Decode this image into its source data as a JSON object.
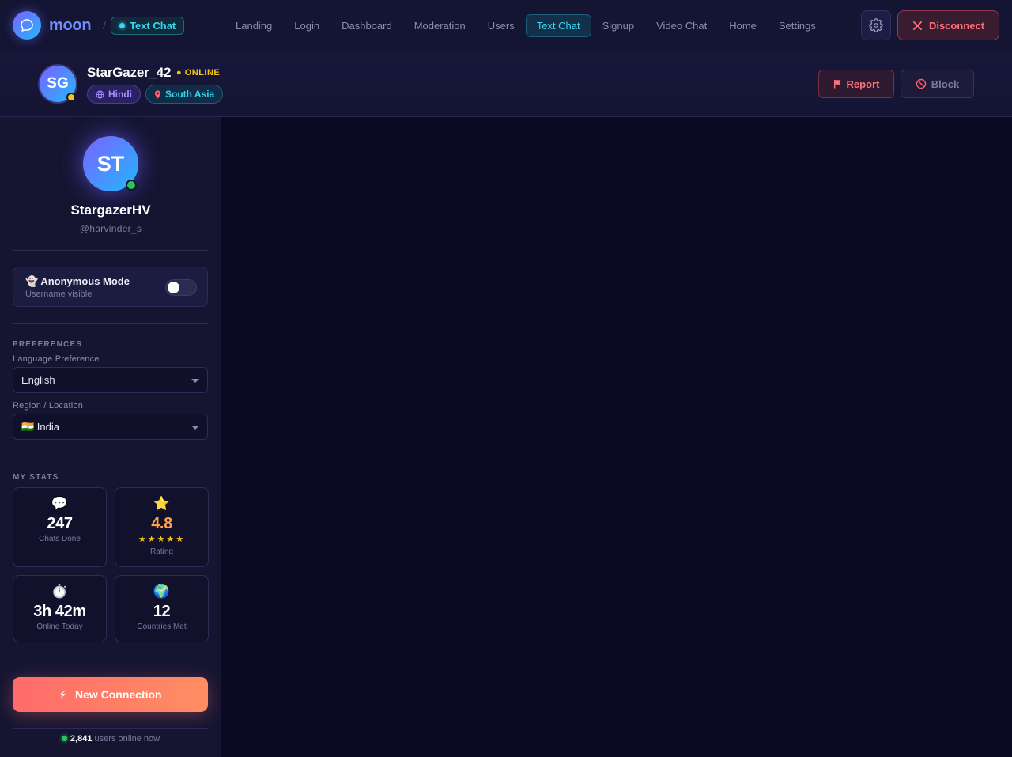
{
  "topbar": {
    "brand": "moon",
    "crumb_sep": "/",
    "crumb": "Text Chat",
    "nav": [
      {
        "label": "Landing",
        "active": false
      },
      {
        "label": "Login",
        "active": false
      },
      {
        "label": "Dashboard",
        "active": false
      },
      {
        "label": "Moderation",
        "active": false
      },
      {
        "label": "Users",
        "active": false
      },
      {
        "label": "Text Chat",
        "active": true
      },
      {
        "label": "Signup",
        "active": false
      },
      {
        "label": "Video Chat",
        "active": false
      },
      {
        "label": "Home",
        "active": false
      },
      {
        "label": "Settings",
        "active": false
      }
    ],
    "settings_icon": "gear-icon",
    "disconnect_label": "Disconnect"
  },
  "peer": {
    "initials": "SG",
    "name": "StarGazer_42",
    "status": "● ONLINE",
    "language_tag": "Hindi",
    "region_tag": "South Asia",
    "report_label": "Report",
    "block_label": "Block"
  },
  "sidebar": {
    "profile": {
      "initials": "ST",
      "display_name": "StargazerHV",
      "handle": "@harvinder_s"
    },
    "anonymous": {
      "title": "👻 Anonymous Mode",
      "subtitle": "Username visible",
      "enabled": false
    },
    "preferences": {
      "heading": "PREFERENCES",
      "language_label": "Language Preference",
      "language_value": "English",
      "region_label": "Region / Location",
      "region_value": "🇮🇳 India"
    },
    "stats": {
      "heading": "MY STATS",
      "items": [
        {
          "icon": "💬",
          "value": "247",
          "label": "Chats Done"
        },
        {
          "icon": "⭐",
          "value": "4.8",
          "stars": "★★★★★",
          "label": "Rating"
        },
        {
          "icon": "⏱️",
          "value": "3h 42m",
          "label": "Online Today"
        },
        {
          "icon": "🌍",
          "value": "12",
          "label": "Countries Met"
        }
      ]
    },
    "new_connection_label": "New Connection",
    "online": {
      "count": "2,841",
      "suffix": "users online now"
    }
  },
  "colors": {
    "accent_cyan": "#35d6f0",
    "accent_coral": "#ff6b6b",
    "online_green": "#27c85a",
    "peer_status_yellow": "#f5c518"
  }
}
